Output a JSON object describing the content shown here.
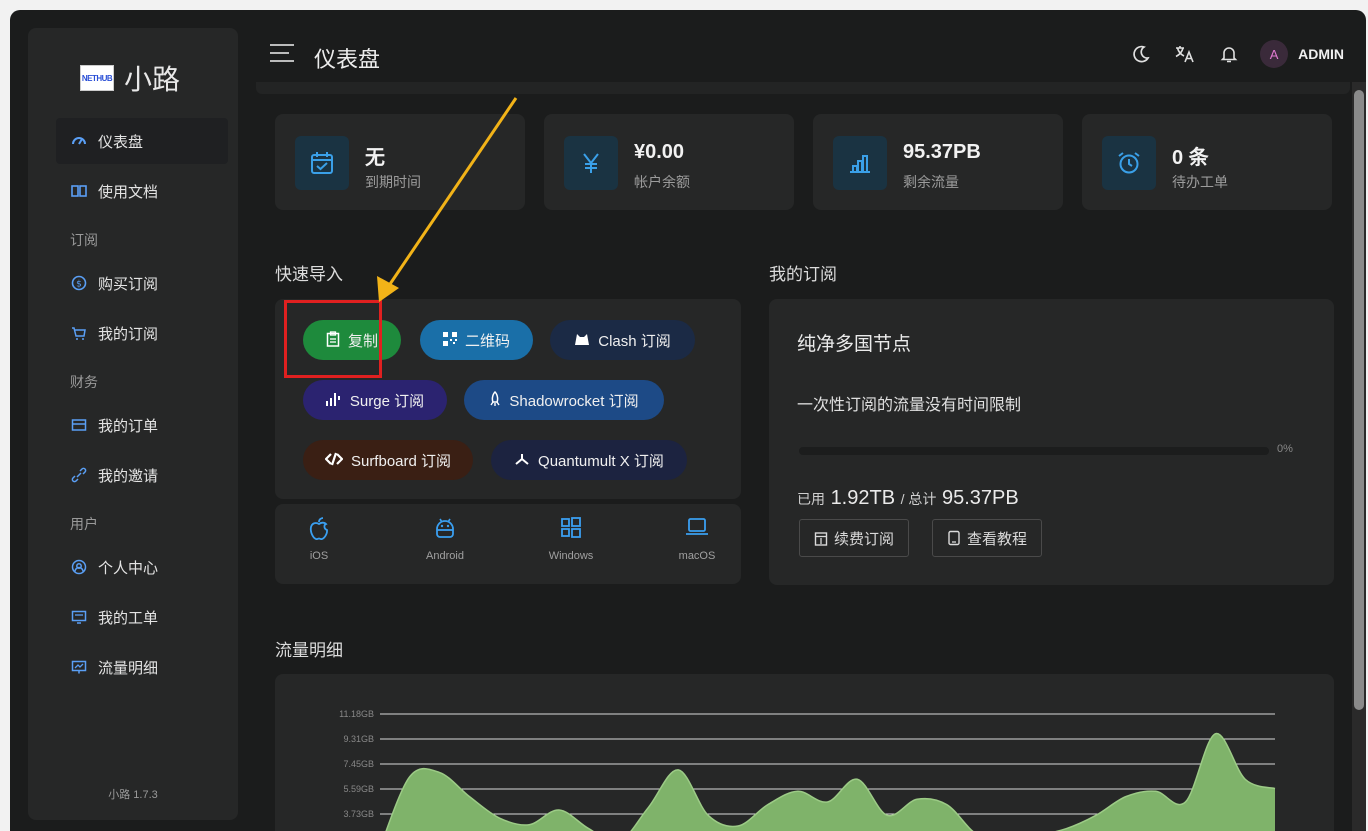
{
  "brand": {
    "logo_text": "NETHUB",
    "name": "小路"
  },
  "sidebar": {
    "items_top": [
      {
        "label": "仪表盘",
        "icon": "dashboard-icon",
        "active": true
      },
      {
        "label": "使用文档",
        "icon": "book-icon"
      }
    ],
    "groups": [
      {
        "title": "订阅",
        "items": [
          {
            "label": "购买订阅",
            "icon": "coin-icon"
          },
          {
            "label": "我的订阅",
            "icon": "cart-icon"
          }
        ]
      },
      {
        "title": "财务",
        "items": [
          {
            "label": "我的订单",
            "icon": "order-icon"
          },
          {
            "label": "我的邀请",
            "icon": "invite-icon"
          }
        ]
      },
      {
        "title": "用户",
        "items": [
          {
            "label": "个人中心",
            "icon": "user-circle-icon"
          },
          {
            "label": "我的工单",
            "icon": "ticket-icon"
          },
          {
            "label": "流量明细",
            "icon": "traffic-icon"
          }
        ]
      }
    ],
    "version": "小路 1.7.3"
  },
  "header": {
    "title": "仪表盘",
    "avatar_letter": "A",
    "username": "ADMIN"
  },
  "stats": [
    {
      "value": "无",
      "label": "到期时间",
      "icon": "calendar-icon"
    },
    {
      "value": "¥0.00",
      "label": "帐户余额",
      "icon": "yen-icon"
    },
    {
      "value": "95.37PB",
      "label": "剩余流量",
      "icon": "bar-chart-icon"
    },
    {
      "value": "0 条",
      "label": "待办工单",
      "icon": "alarm-icon"
    }
  ],
  "quick_import": {
    "title": "快速导入",
    "buttons": [
      {
        "label": "复制",
        "icon": "clipboard-icon",
        "color": "#1e8a3c"
      },
      {
        "label": "二维码",
        "icon": "qrcode-icon",
        "color": "#1a6fa8"
      },
      {
        "label": "Clash 订阅",
        "icon": "clash-icon",
        "color": "#1b2a45"
      },
      {
        "label": "Surge 订阅",
        "icon": "surge-icon",
        "color": "#2b2370"
      },
      {
        "label": "Shadowrocket 订阅",
        "icon": "rocket-icon",
        "color": "#1d4a86"
      },
      {
        "label": "Surfboard 订阅",
        "icon": "surfboard-icon",
        "color": "#3a1f14"
      },
      {
        "label": "Quantumult X 订阅",
        "icon": "quantumult-icon",
        "color": "#1c2340"
      }
    ],
    "platforms": [
      {
        "label": "iOS",
        "icon": "apple-icon"
      },
      {
        "label": "Android",
        "icon": "android-icon"
      },
      {
        "label": "Windows",
        "icon": "windows-icon"
      },
      {
        "label": "macOS",
        "icon": "laptop-icon"
      }
    ]
  },
  "subscription": {
    "title": "我的订阅",
    "plan_name": "纯净多国节点",
    "description": "一次性订阅的流量没有时间限制",
    "progress_percent": 0,
    "progress_label": "0%",
    "used_prefix": "已用",
    "used": "1.92TB",
    "separator": "/ 总计",
    "total": "95.37PB",
    "renew_label": "续费订阅",
    "tutorial_label": "查看教程"
  },
  "traffic": {
    "title": "流量明细",
    "chart_data": {
      "type": "area",
      "y_ticks": [
        "11.18GB",
        "9.31GB",
        "7.45GB",
        "5.59GB",
        "3.73GB"
      ],
      "y_tick_values": [
        11.18,
        9.31,
        7.45,
        5.59,
        3.73
      ],
      "series_color": "#7fb36a",
      "values": [
        1.2,
        6.5,
        6.8,
        5.0,
        3.4,
        2.9,
        4.0,
        2.6,
        1.6,
        4.2,
        7.0,
        3.6,
        2.8,
        4.4,
        5.4,
        4.6,
        6.3,
        3.6,
        4.8,
        4.4,
        2.2,
        1.9,
        2.1,
        2.6,
        3.6,
        5.0,
        5.4,
        4.6,
        9.7,
        6.3,
        5.6
      ]
    }
  },
  "colors": {
    "accent": "#3a9ff0",
    "copy_highlight": "#e02020",
    "arrow": "#f2b318"
  }
}
